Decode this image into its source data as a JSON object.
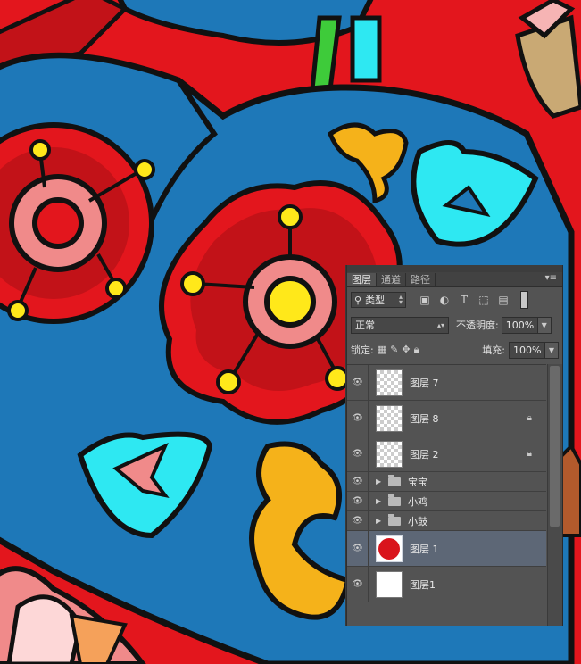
{
  "panel": {
    "tabs": [
      {
        "label": "图层",
        "active": true
      },
      {
        "label": "通道",
        "active": false
      },
      {
        "label": "路径",
        "active": false
      }
    ],
    "menu_icon": "panel-menu-icon",
    "filter": {
      "label": "类型",
      "icon": "search-icon"
    },
    "filter_icons": [
      "image-filter-icon",
      "adjustment-filter-icon",
      "text-filter-icon",
      "shape-filter-icon",
      "smart-object-filter-icon"
    ],
    "blend_mode": "正常",
    "opacity_label": "不透明度:",
    "opacity_value": "100%",
    "lock_label": "锁定:",
    "fill_label": "填充:",
    "fill_value": "100%",
    "layers": [
      {
        "name": "图层 7",
        "type": "layer",
        "thumb": "transparent",
        "locked": false,
        "selected": false
      },
      {
        "name": "图层 8",
        "type": "layer",
        "thumb": "transparent",
        "locked": true,
        "selected": false
      },
      {
        "name": "图层 2",
        "type": "layer",
        "thumb": "transparent",
        "locked": true,
        "selected": false
      },
      {
        "name": "宝宝",
        "type": "group"
      },
      {
        "name": "小鸡",
        "type": "group"
      },
      {
        "name": "小鼓",
        "type": "group"
      },
      {
        "name": "图层 1",
        "type": "layer",
        "thumb": "red-circle",
        "locked": false,
        "selected": true
      },
      {
        "name": "图层1",
        "type": "layer",
        "thumb": "white",
        "locked": false,
        "selected": false
      }
    ]
  },
  "colors": {
    "background_red": "#e3161d",
    "blue": "#1e78b8",
    "pink": "#f08a8a",
    "yellow": "#ffe81a",
    "cyan": "#2ee8f2",
    "orange": "#f5b21a",
    "panel_bg": "#535353",
    "selected_row": "#5d6776"
  }
}
